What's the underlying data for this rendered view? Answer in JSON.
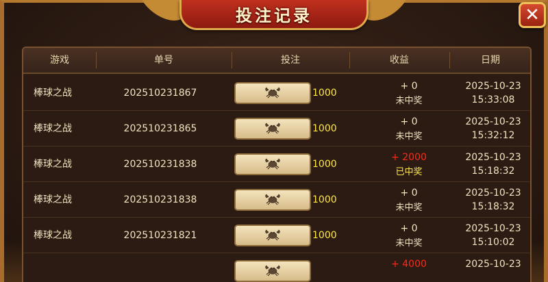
{
  "title": "投注记录",
  "close_icon": "close-icon",
  "bet_icon": "crab-icon",
  "headers": [
    "游戏",
    "单号",
    "投注",
    "收益",
    "日期"
  ],
  "rows": [
    {
      "game": "棒球之战",
      "order": "202510231867",
      "bet": "1000",
      "gain": "+ 0",
      "result": "未中奖",
      "date": "2025-10-23",
      "time": "15:33:08",
      "win": false
    },
    {
      "game": "棒球之战",
      "order": "202510231865",
      "bet": "1000",
      "gain": "+ 0",
      "result": "未中奖",
      "date": "2025-10-23",
      "time": "15:32:12",
      "win": false
    },
    {
      "game": "棒球之战",
      "order": "202510231838",
      "bet": "1000",
      "gain": "+ 2000",
      "result": "已中奖",
      "date": "2025-10-23",
      "time": "15:18:32",
      "win": true
    },
    {
      "game": "棒球之战",
      "order": "202510231838",
      "bet": "1000",
      "gain": "+ 0",
      "result": "未中奖",
      "date": "2025-10-23",
      "time": "15:18:32",
      "win": false
    },
    {
      "game": "棒球之战",
      "order": "202510231821",
      "bet": "1000",
      "gain": "+ 0",
      "result": "未中奖",
      "date": "2025-10-23",
      "time": "15:10:02",
      "win": false
    },
    {
      "game": "",
      "order": "",
      "bet": "",
      "gain": "+ 4000",
      "result": "",
      "date": "2025-10-23",
      "time": "",
      "win": true
    }
  ]
}
